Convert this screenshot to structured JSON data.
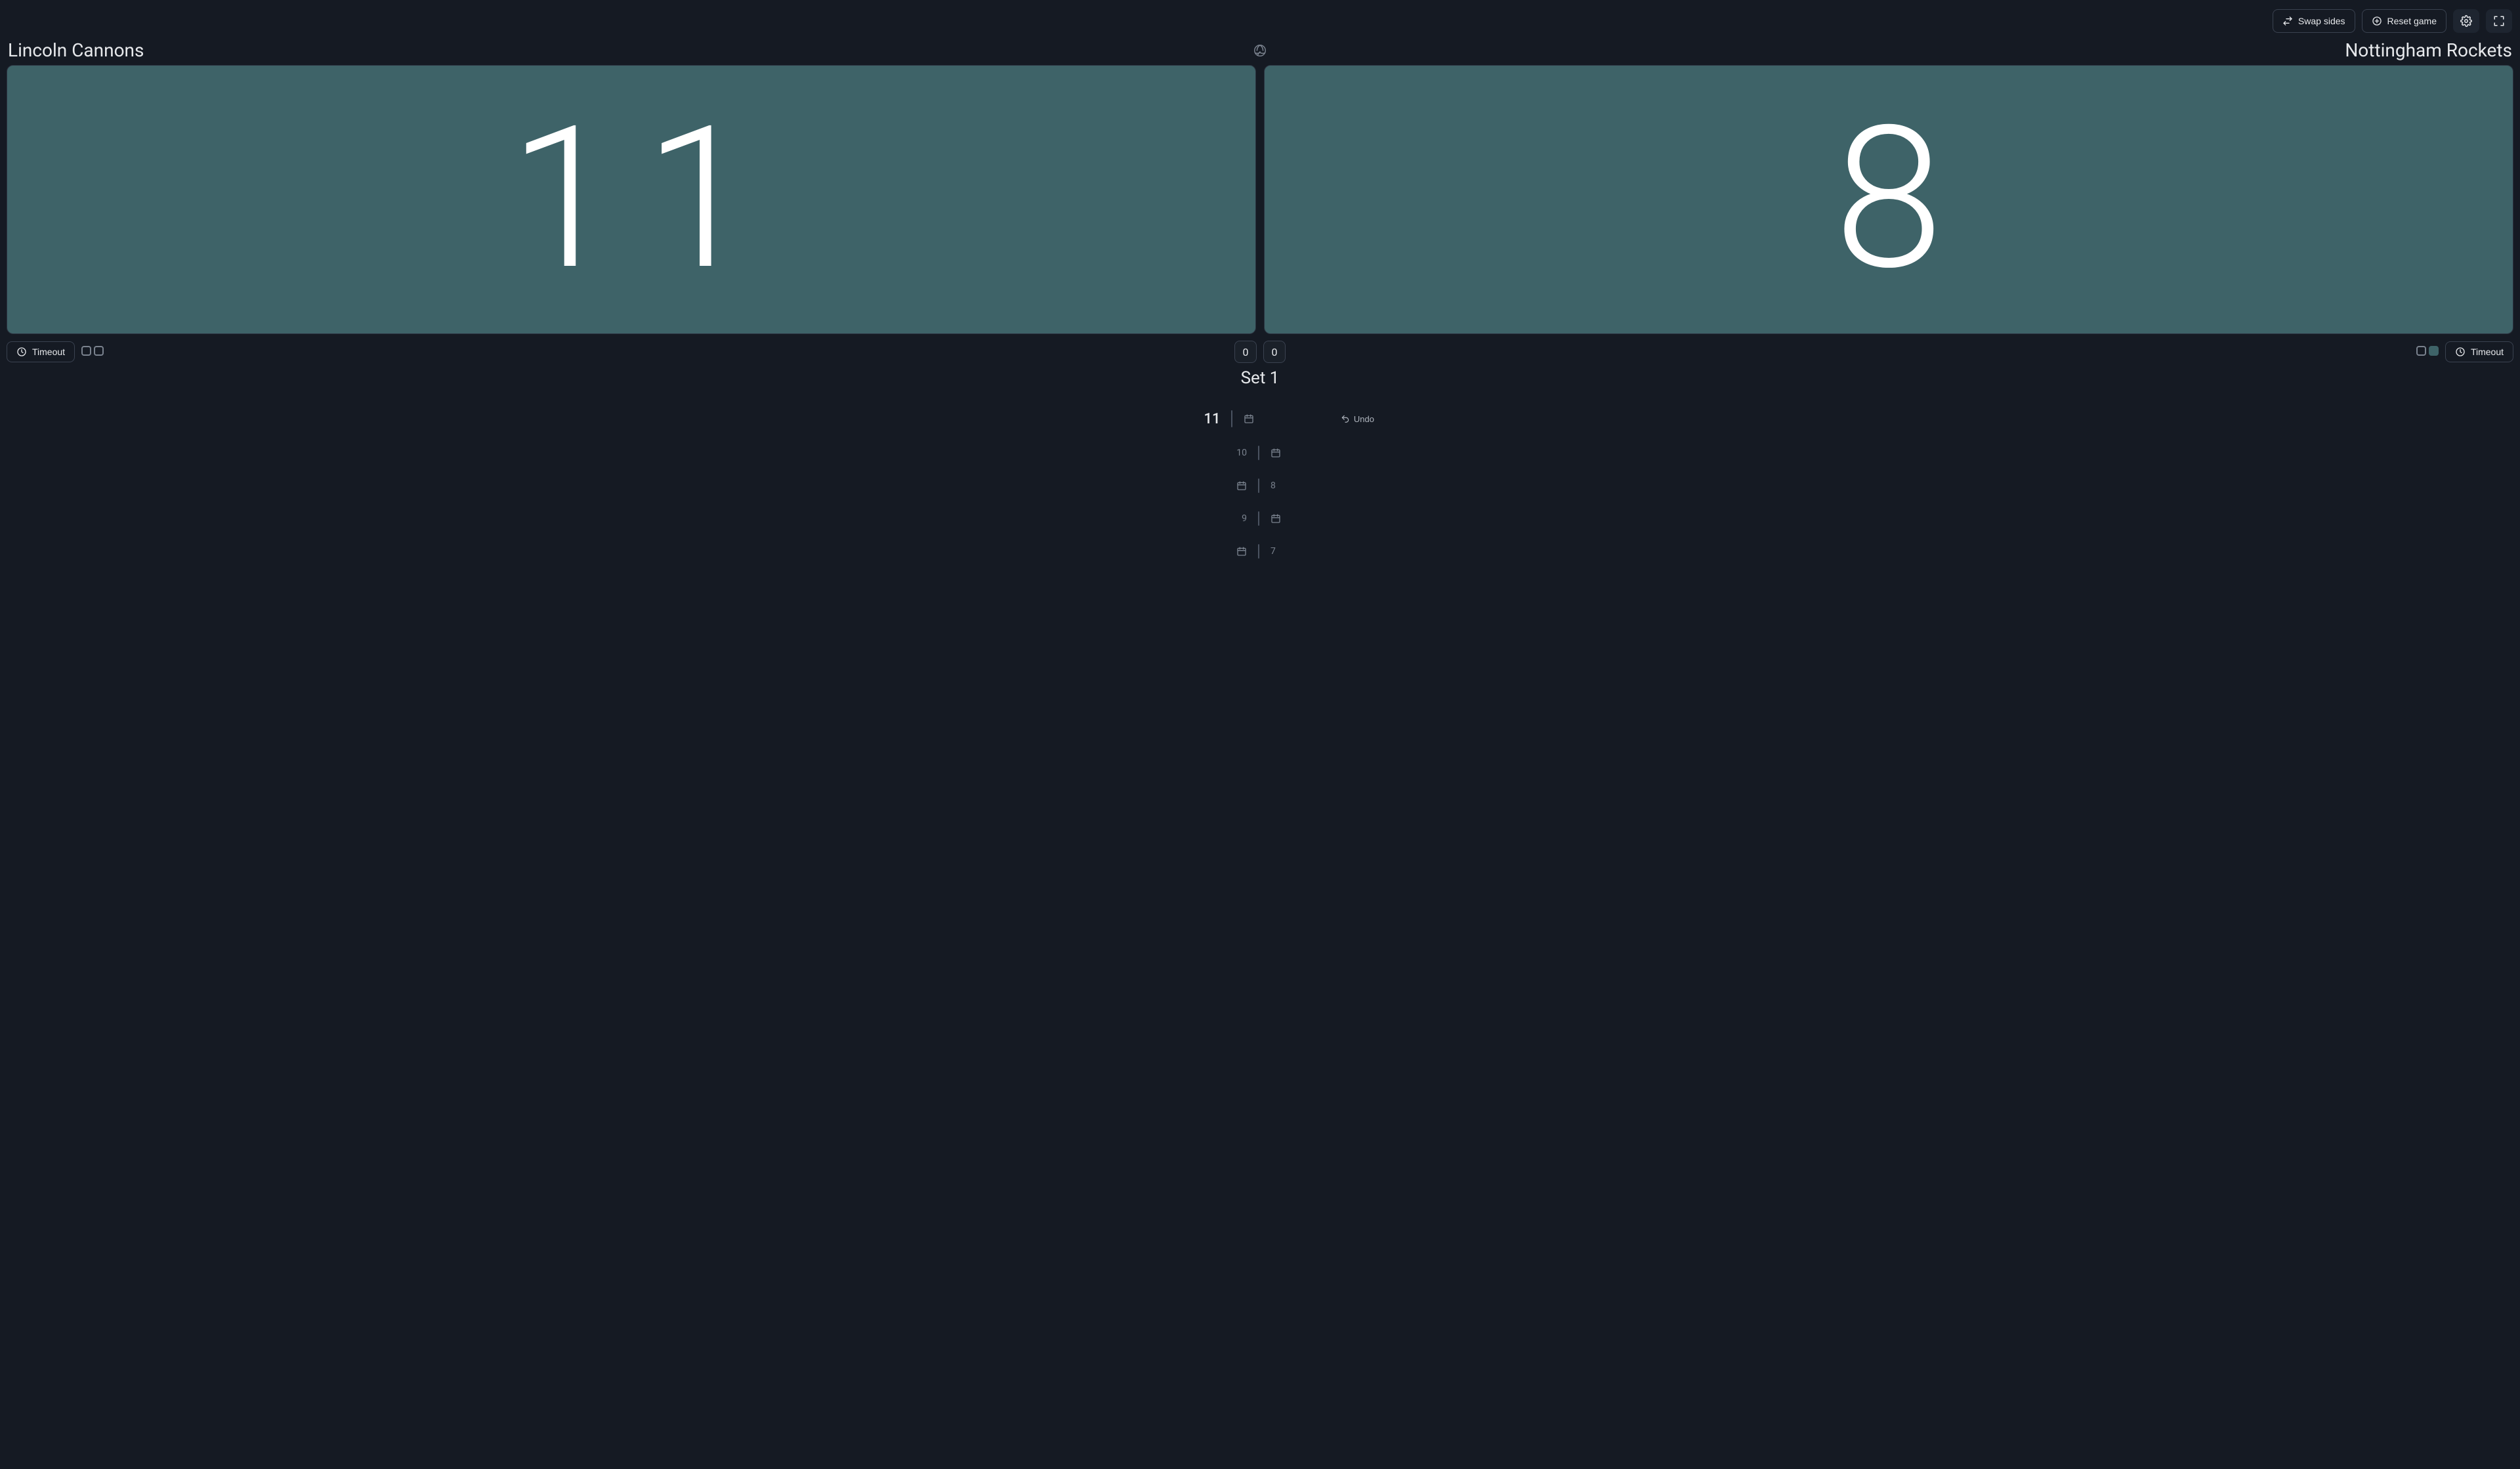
{
  "topbar": {
    "swap_label": "Swap sides",
    "reset_label": "Reset game"
  },
  "teams": {
    "left": {
      "name": "Lincoln Cannons",
      "score": "11",
      "sets": "0",
      "timeouts_used": 0,
      "timeouts_total": 2
    },
    "right": {
      "name": "Nottingham Rockets",
      "score": "8",
      "sets": "0",
      "timeouts_used": 1,
      "timeouts_total": 2
    }
  },
  "set_label": "Set 1",
  "timeout_label": "Timeout",
  "undo_label": "Undo",
  "log": [
    {
      "side": "left",
      "value": "11",
      "latest": true
    },
    {
      "side": "left",
      "value": "10",
      "latest": false
    },
    {
      "side": "right",
      "value": "8",
      "latest": false
    },
    {
      "side": "left",
      "value": "9",
      "latest": false
    },
    {
      "side": "right",
      "value": "7",
      "latest": false
    }
  ]
}
